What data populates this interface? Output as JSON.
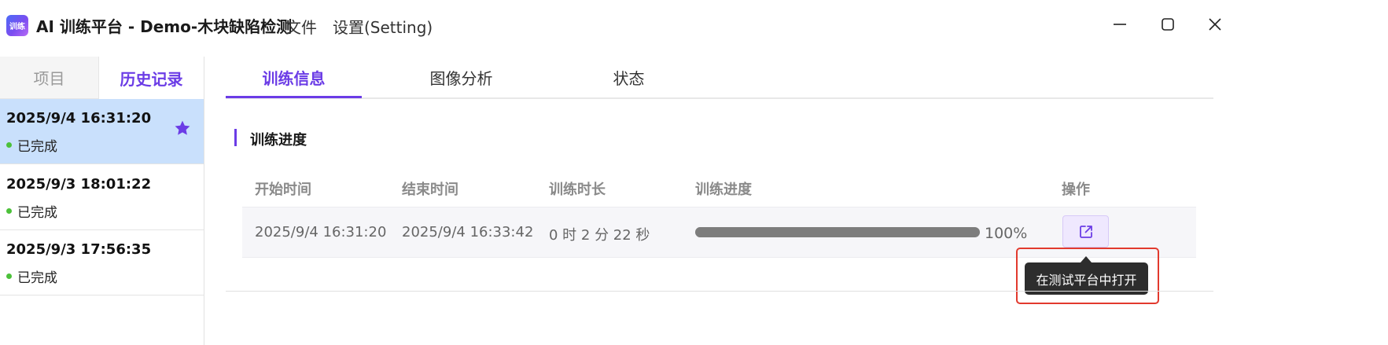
{
  "app": {
    "logo_text": "训练",
    "title": "AI 训练平台 - Demo-木块缺陷检测"
  },
  "menu": {
    "file": "文件",
    "settings": "设置(Setting)"
  },
  "sidebar": {
    "tabs": {
      "project": "项目",
      "history": "历史记录"
    },
    "items": [
      {
        "time": "2025/9/4 16:31:20",
        "status": "已完成",
        "selected": true,
        "starred": true
      },
      {
        "time": "2025/9/3 18:01:22",
        "status": "已完成",
        "selected": false,
        "starred": false
      },
      {
        "time": "2025/9/3 17:56:35",
        "status": "已完成",
        "selected": false,
        "starred": false
      }
    ]
  },
  "main": {
    "tabs": [
      "训练信息",
      "图像分析",
      "状态"
    ],
    "active_tab": 0,
    "section_title": "训练进度",
    "table": {
      "headers": {
        "start": "开始时间",
        "end": "结束时间",
        "duration": "训练时长",
        "progress": "训练进度",
        "action": "操作"
      },
      "row": {
        "start": "2025/9/4 16:31:20",
        "end": "2025/9/4 16:33:42",
        "duration": "0 时 2 分 22 秒",
        "progress": 1.0,
        "progress_text": "100%"
      }
    },
    "tooltip": "在测试平台中打开"
  },
  "colors": {
    "accent": "#6b3ce6",
    "selected_row": "#c9e0fc",
    "status_done": "#4cc13a",
    "highlight": "#e23a2e"
  },
  "icons": {
    "app": "app-logo-icon",
    "minimize": "minimize-icon",
    "maximize": "maximize-icon",
    "close": "close-icon",
    "star": "star-icon",
    "open_external": "external-link-icon"
  }
}
